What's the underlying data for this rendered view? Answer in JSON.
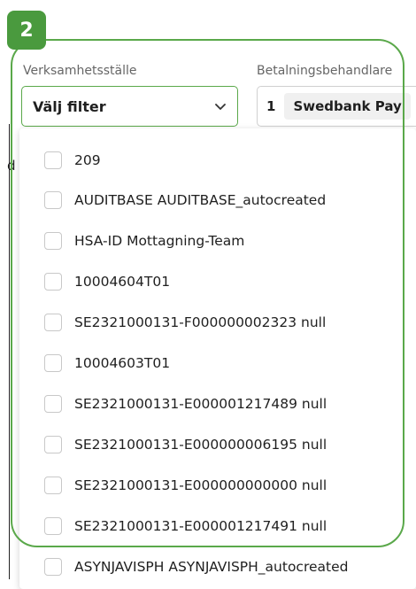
{
  "step_badge": "2",
  "filters": {
    "location": {
      "label": "Verksamhetsställe",
      "value": "Välj filter"
    },
    "processor": {
      "label": "Betalningsbehandlare",
      "count": "1",
      "value": "Swedbank Pay"
    }
  },
  "background_text": "d",
  "options": [
    {
      "label": "209"
    },
    {
      "label": "AUDITBASE AUDITBASE_autocreated"
    },
    {
      "label": "HSA-ID Mottagning-Team"
    },
    {
      "label": "10004604T01"
    },
    {
      "label": "SE2321000131-F000000002323 null"
    },
    {
      "label": "10004603T01"
    },
    {
      "label": "SE2321000131-E000001217489 null"
    },
    {
      "label": "SE2321000131-E000000006195 null"
    },
    {
      "label": "SE2321000131-E000000000000 null"
    },
    {
      "label": "SE2321000131-E000001217491 null"
    },
    {
      "label": "ASYNJAVISPH ASYNJAVISPH_autocreated"
    }
  ],
  "colors": {
    "accent": "#4a9a3e"
  },
  "icons": {
    "dropdown": "chevron-down-icon"
  }
}
